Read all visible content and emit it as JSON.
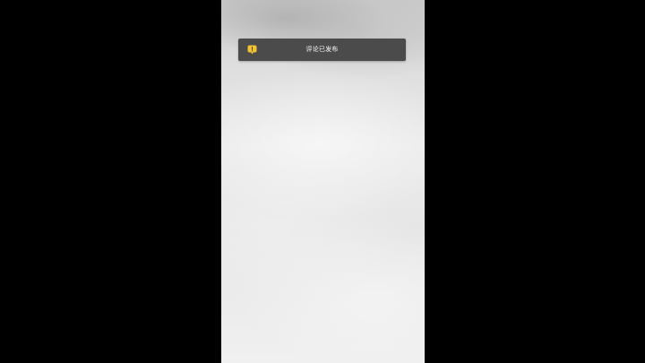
{
  "toast": {
    "message": "评论已发布",
    "icon": "warning-icon",
    "icon_color": "#f2c230",
    "background": "#4b4b4b"
  }
}
